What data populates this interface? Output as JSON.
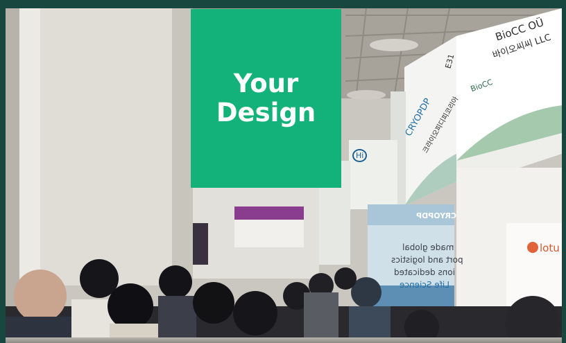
{
  "sign": {
    "line1": "Your",
    "line2": "Design"
  },
  "booths": {
    "bicc_name": "BioCC OÜ",
    "bicc_korean": "바이오씨씨 LLC",
    "bicc_logo": "BioCC",
    "cryopdp_name": "CRYOPDP",
    "cryopdp_korean": "크라이오피디피코리아",
    "booth_code": "E31",
    "banner_brand": "CRYOPDP",
    "banner_line1": "made global",
    "banner_line2": "port and logistics",
    "banner_line3": "ions dedicated",
    "banner_line4": "Life Science",
    "lotus_brand": "lotu",
    "hi_badge": "Hi"
  },
  "colors": {
    "frame": "#17473f",
    "sign": "#12b27a",
    "sign_text": "#ffffff"
  }
}
